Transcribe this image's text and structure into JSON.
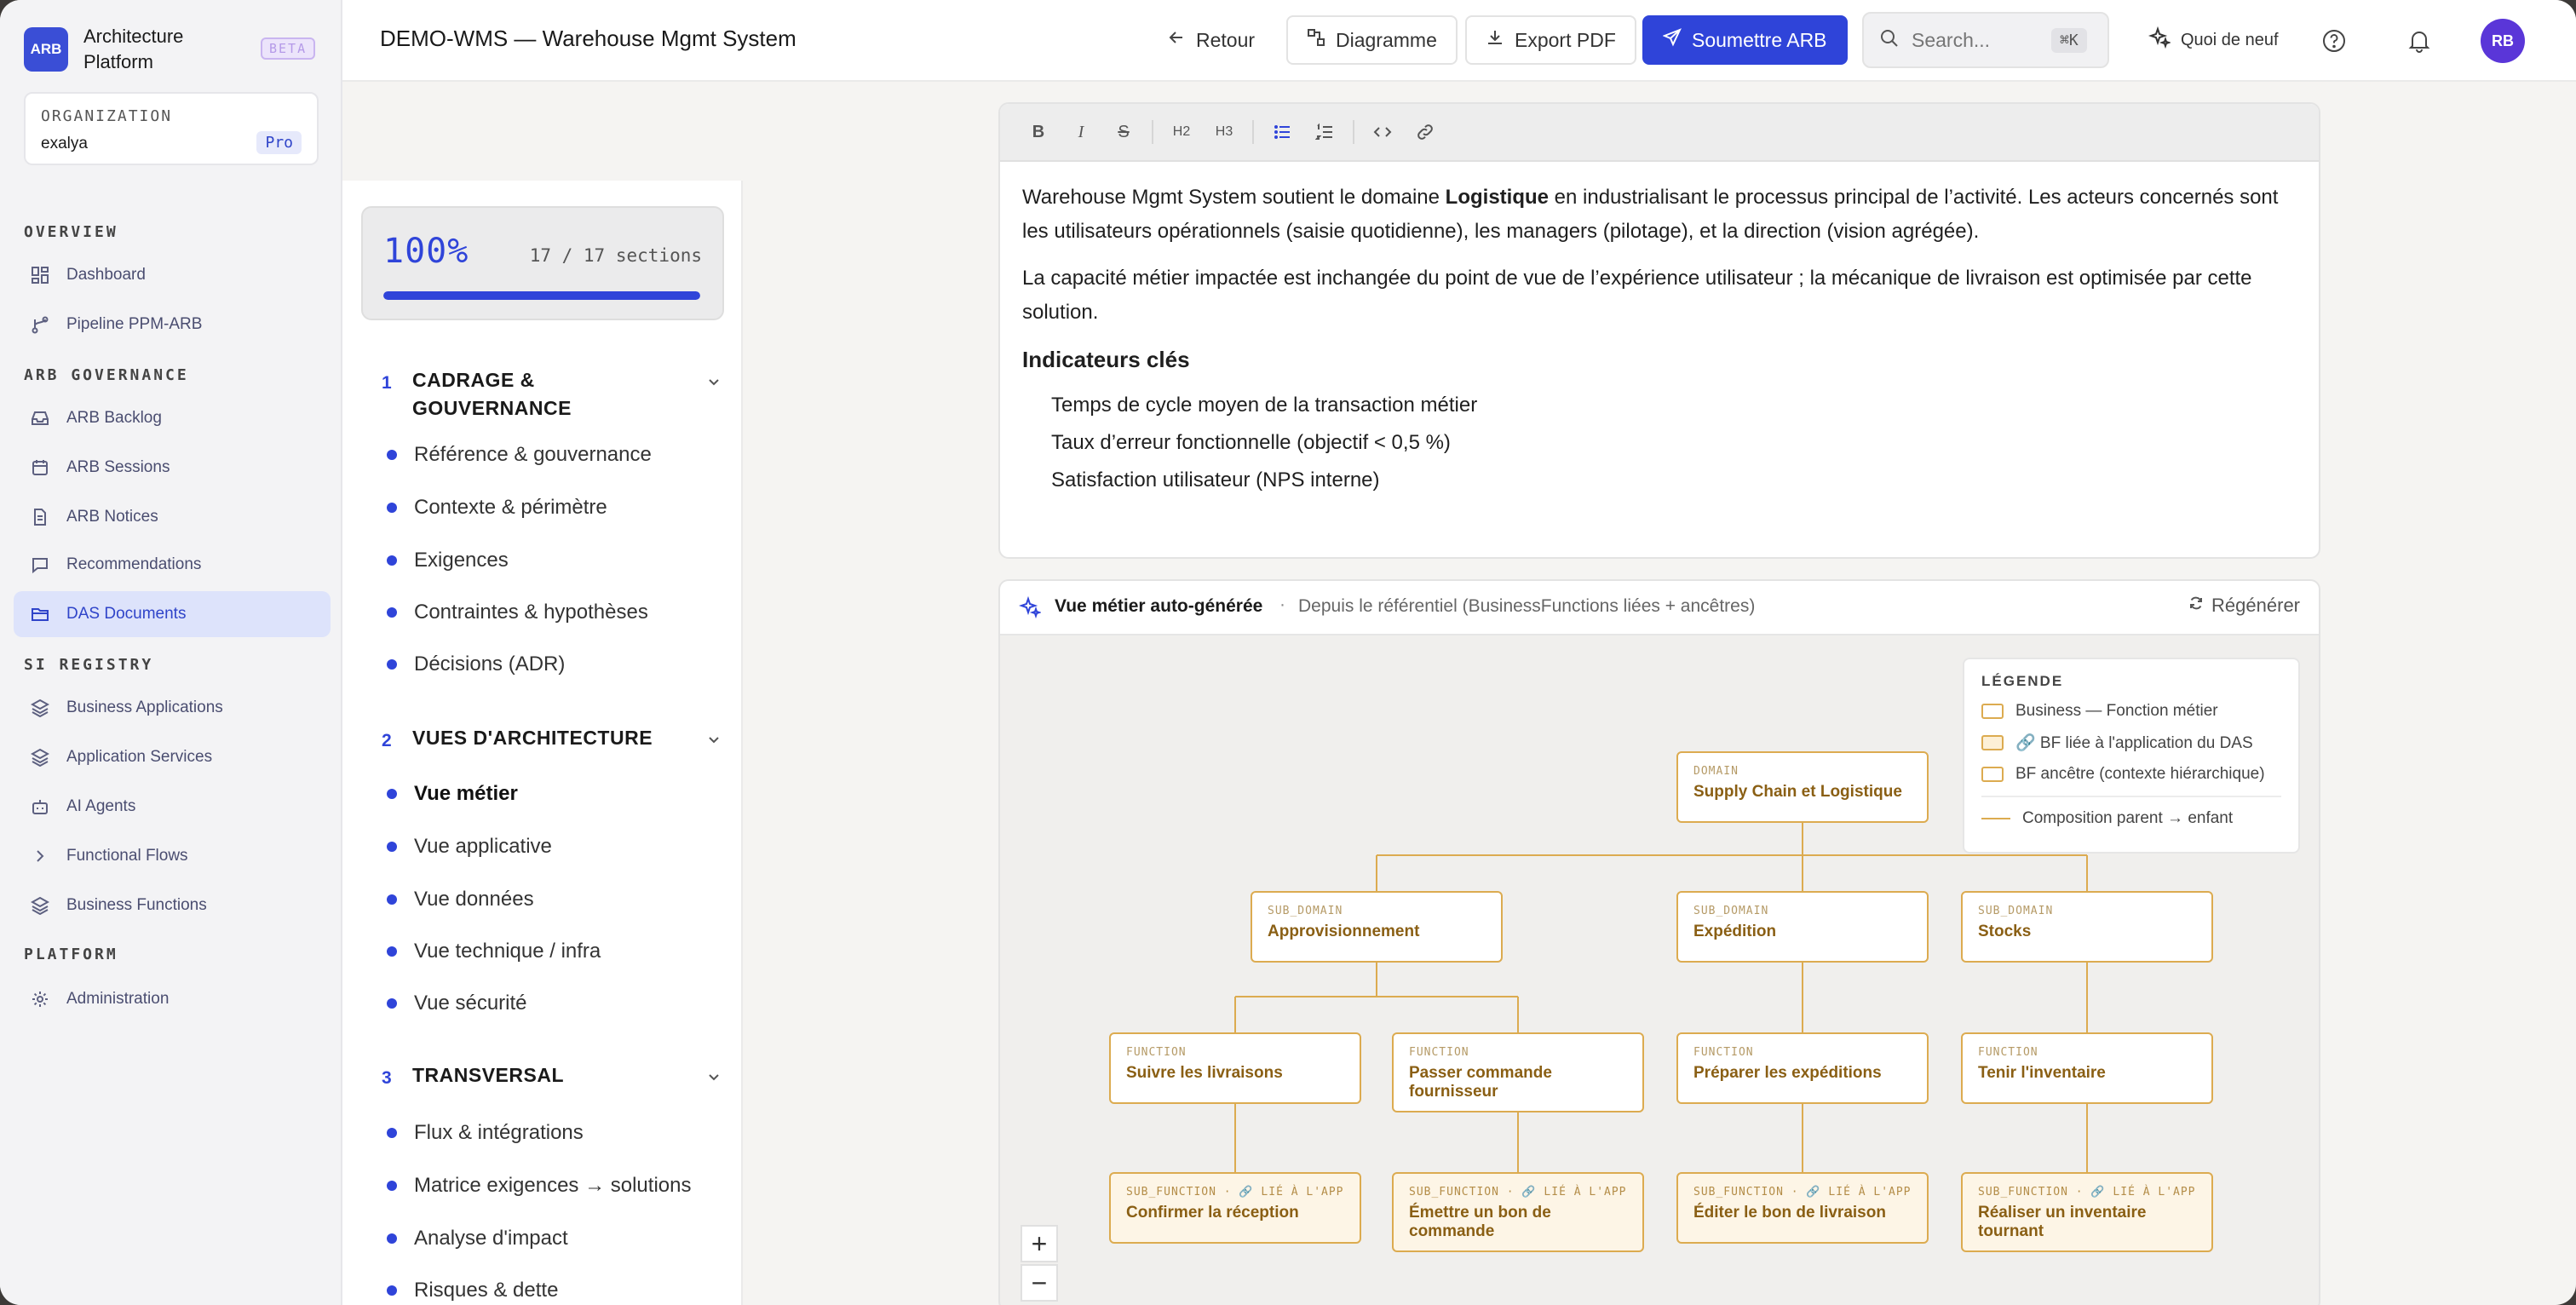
{
  "sidebar": {
    "logo": "ARB",
    "app_name": "Architecture Platform",
    "beta": "BETA",
    "org_label": "ORGANIZATION",
    "org_value": "exalya",
    "plan": "Pro",
    "sections": {
      "overview": "OVERVIEW",
      "governance": "ARB GOVERNANCE",
      "registry": "SI REGISTRY",
      "platform": "PLATFORM"
    },
    "items": [
      {
        "label": "Dashboard",
        "icon": "dashboard-icon"
      },
      {
        "label": "Pipeline PPM-ARB",
        "icon": "pipeline-icon"
      },
      {
        "label": "ARB Backlog",
        "icon": "inbox-icon"
      },
      {
        "label": "ARB Sessions",
        "icon": "calendar-icon"
      },
      {
        "label": "ARB Notices",
        "icon": "document-icon"
      },
      {
        "label": "Recommendations",
        "icon": "message-icon"
      },
      {
        "label": "DAS Documents",
        "icon": "folder-icon",
        "active": true
      },
      {
        "label": "Business Applications",
        "icon": "layers-icon"
      },
      {
        "label": "Application Services",
        "icon": "layers-icon"
      },
      {
        "label": "AI Agents",
        "icon": "robot-icon"
      },
      {
        "label": "Functional Flows",
        "icon": "chevron-right-icon"
      },
      {
        "label": "Business Functions",
        "icon": "layers-icon"
      },
      {
        "label": "Administration",
        "icon": "gear-icon"
      }
    ]
  },
  "header": {
    "title": "DEMO-WMS — Warehouse Mgmt System",
    "back": "Retour",
    "diagram": "Diagramme",
    "export": "Export PDF",
    "submit": "Soumettre ARB",
    "search_placeholder": "Search...",
    "search_kbd": "⌘K",
    "whats_new": "Quoi de neuf",
    "avatar": "RB"
  },
  "toc": {
    "progress_pct": "100%",
    "progress_value": 1.0,
    "progress_count": "17 / 17 sections",
    "sections": [
      {
        "num": "1",
        "title": "CADRAGE & GOUVERNANCE",
        "items": [
          "Référence & gouvernance",
          "Contexte & périmètre",
          "Exigences",
          "Contraintes & hypothèses",
          "Décisions (ADR)"
        ]
      },
      {
        "num": "2",
        "title": "VUES D'ARCHITECTURE",
        "items": [
          "Vue métier",
          "Vue applicative",
          "Vue données",
          "Vue technique / infra",
          "Vue sécurité"
        ]
      },
      {
        "num": "3",
        "title": "TRANSVERSAL",
        "items": [
          "Flux & intégrations",
          "Matrice exigences → solutions",
          "Analyse d'impact",
          "Risques & dette"
        ]
      }
    ]
  },
  "editor": {
    "toolbar": [
      "B",
      "I",
      "S",
      "H2",
      "H3",
      "bullet-list",
      "numbered-list",
      "code",
      "link"
    ],
    "p1_before": "Warehouse Mgmt System soutient le domaine ",
    "p1_bold": "Logistique",
    "p1_after": " en industrialisant le processus principal de l’activité. Les acteurs concernés sont les utilisateurs opérationnels (saisie quotidienne), les managers (pilotage), et la direction (vision agrégée).",
    "p2": "La capacité métier impactée est inchangée du point de vue de l’expérience utilisateur ; la mécanique de livraison est optimisée par cette solution.",
    "h3": "Indicateurs clés",
    "list": [
      "Temps de cycle moyen de la transaction métier",
      "Taux d’erreur fonctionnelle (objectif < 0,5 %)",
      "Satisfaction utilisateur (NPS interne)"
    ]
  },
  "diagram": {
    "title": "Vue métier auto-générée",
    "subtitle": "Depuis le référentiel (BusinessFunctions liées + ancêtres)",
    "regenerate": "Régénérer",
    "legend": {
      "title": "LÉGENDE",
      "business": "Business — Fonction métier",
      "linked": "🔗 BF liée à l'application du DAS",
      "ancestor": "BF ancêtre (contexte hiérarchique)",
      "composition": "Composition parent → enfant"
    },
    "nodes": {
      "domain": {
        "type": "DOMAIN",
        "name": "Supply Chain et Logistique"
      },
      "sd1": {
        "type": "SUB_DOMAIN",
        "name": "Approvisionnement"
      },
      "sd2": {
        "type": "SUB_DOMAIN",
        "name": "Expédition"
      },
      "sd3": {
        "type": "SUB_DOMAIN",
        "name": "Stocks"
      },
      "f1": {
        "type": "FUNCTION",
        "name": "Suivre les livraisons"
      },
      "f2": {
        "type": "FUNCTION",
        "name": "Passer commande fournisseur"
      },
      "f3": {
        "type": "FUNCTION",
        "name": "Préparer les expéditions"
      },
      "f4": {
        "type": "FUNCTION",
        "name": "Tenir l'inventaire"
      },
      "s1": {
        "type": "SUB_FUNCTION · 🔗 LIÉ À L'APP",
        "name": "Confirmer la réception"
      },
      "s2": {
        "type": "SUB_FUNCTION · 🔗 LIÉ À L'APP",
        "name": "Émettre un bon de commande"
      },
      "s3": {
        "type": "SUB_FUNCTION · 🔗 LIÉ À L'APP",
        "name": "Éditer le bon de livraison"
      },
      "s4": {
        "type": "SUB_FUNCTION · 🔗 LIÉ À L'APP",
        "name": "Réaliser un inventaire tournant"
      }
    },
    "zoom_in": "+",
    "zoom_out": "−"
  },
  "colors": {
    "accent": "#2f44d9",
    "node_border": "#dcab50",
    "node_text": "#8a5f14"
  }
}
